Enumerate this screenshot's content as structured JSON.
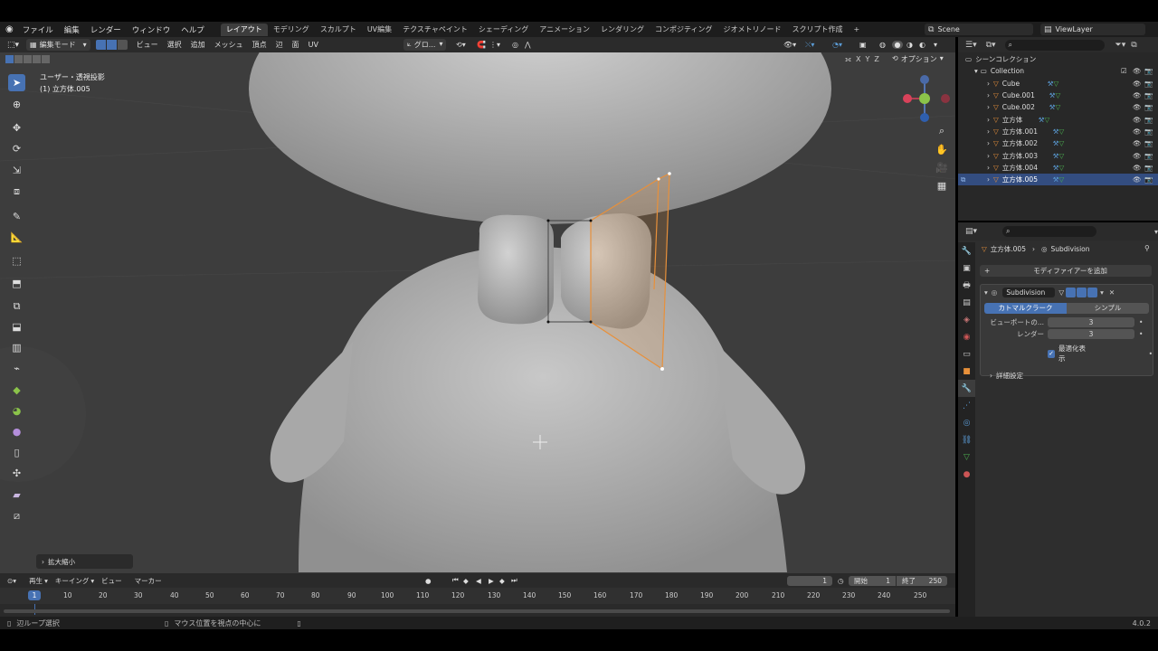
{
  "menu": [
    "ファイル",
    "編集",
    "レンダー",
    "ウィンドウ",
    "ヘルプ"
  ],
  "workspaces": [
    "レイアウト",
    "モデリング",
    "スカルプト",
    "UV編集",
    "テクスチャペイント",
    "シェーディング",
    "アニメーション",
    "レンダリング",
    "コンポジティング",
    "ジオメトリノード",
    "スクリプト作成"
  ],
  "active_workspace": "レイアウト",
  "add_workspace": "+",
  "scene": "Scene",
  "view_layer": "ViewLayer",
  "viewport_header": {
    "mode": "編集モード",
    "menus": [
      "ビュー",
      "選択",
      "追加",
      "メッシュ",
      "頂点",
      "辺",
      "面",
      "UV"
    ],
    "transform_orientation": "グロ...",
    "axes": [
      "X",
      "Y",
      "Z"
    ],
    "options": "オプション"
  },
  "viewport": {
    "view_label": "ユーザー・透視投影",
    "object_label": "(1) 立方体.005",
    "last_op": "拡大縮小"
  },
  "tools": [
    "select-box",
    "cursor",
    "move",
    "rotate",
    "scale",
    "transform",
    "annotate",
    "measure",
    "add-cube",
    "extrude",
    "inset",
    "bevel",
    "loop-cut",
    "knife",
    "poly-build",
    "spin",
    "smooth",
    "edge-slide",
    "shrink-fatten",
    "shear",
    "rip"
  ],
  "outliner": {
    "title": "シーンコレクション",
    "collection": "Collection",
    "items": [
      "Cube",
      "Cube.001",
      "Cube.002",
      "立方体",
      "立方体.001",
      "立方体.002",
      "立方体.003",
      "立方体.004",
      "立方体.005"
    ],
    "selected": "立方体.005"
  },
  "properties": {
    "breadcrumb_object": "立方体.005",
    "breadcrumb_modifier": "Subdivision",
    "add_modifier": "モディファイアーを追加",
    "modifier_name": "Subdivision",
    "type_catmull": "カトマルクラーク",
    "type_simple": "シンプル",
    "levels_viewport_label": "ビューポートの...",
    "levels_viewport": "3",
    "render_label": "レンダー",
    "render_levels": "3",
    "optimal_display": "最適化表示",
    "advanced": "詳細設定"
  },
  "timeline": {
    "menus": [
      "再生",
      "キーイング",
      "ビュー",
      "マーカー"
    ],
    "current_frame": "1",
    "start_label": "開始",
    "start": "1",
    "end_label": "終了",
    "end": "250",
    "ticks": [
      "1",
      "10",
      "20",
      "30",
      "40",
      "50",
      "60",
      "70",
      "80",
      "90",
      "100",
      "110",
      "120",
      "130",
      "140",
      "150",
      "160",
      "170",
      "180",
      "190",
      "200",
      "210",
      "220",
      "230",
      "240",
      "250"
    ]
  },
  "status": {
    "left": "辺ループ選択",
    "middle": "マウス位置を視点の中心に",
    "version": "4.0.2"
  },
  "colors": {
    "accent": "#4772b3",
    "selected_edge": "#e8903a",
    "mesh": "#b8b8b8",
    "bg": "#3d3d3d"
  }
}
